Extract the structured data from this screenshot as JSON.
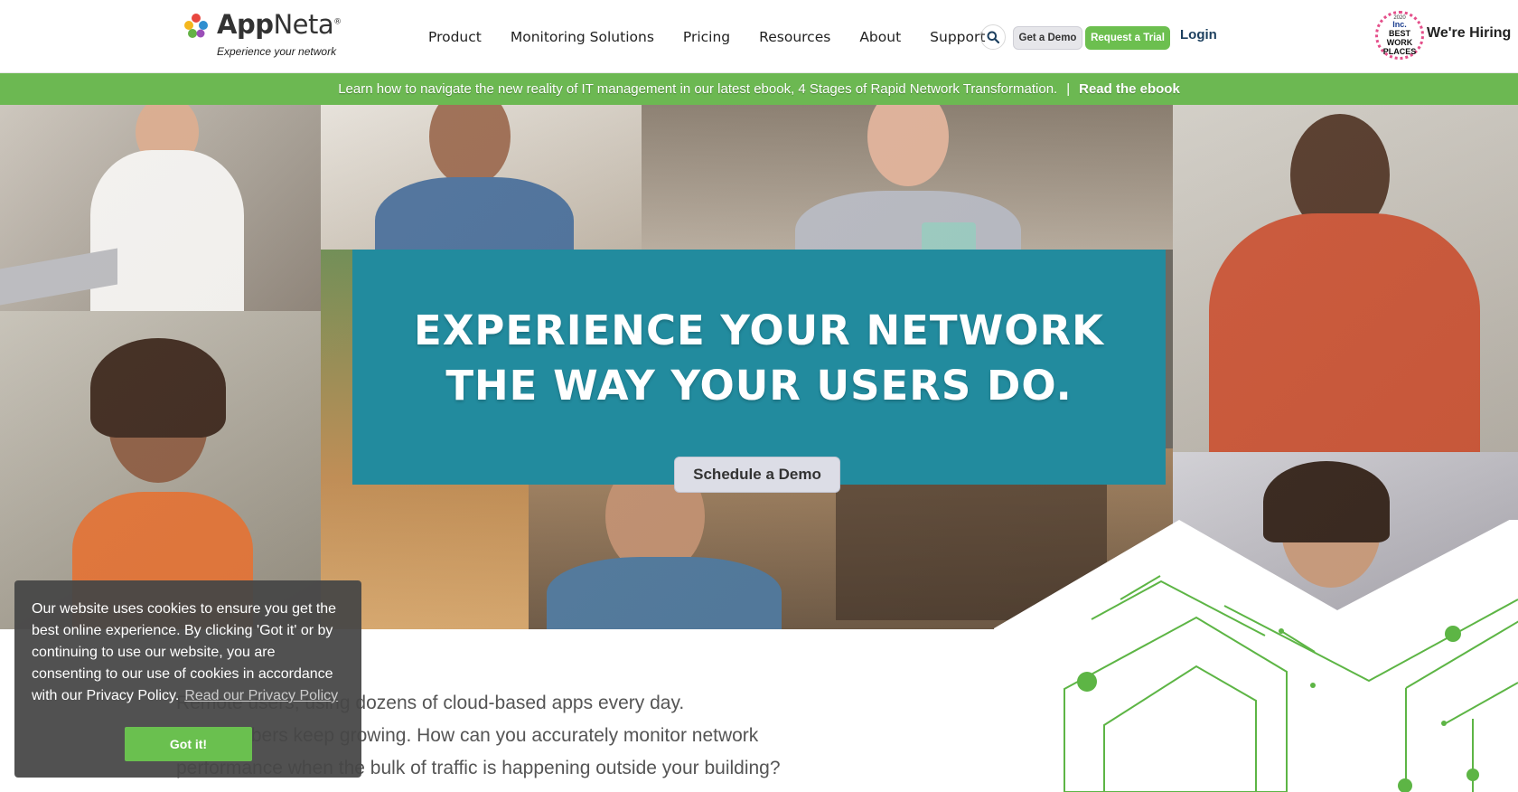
{
  "brand": {
    "name_bold": "App",
    "name_regular": "Neta",
    "tagline": "Experience your network",
    "trademark": "®"
  },
  "nav": {
    "items": [
      "Product",
      "Monitoring Solutions",
      "Pricing",
      "Resources",
      "About",
      "Support"
    ],
    "search_icon": "search-icon",
    "get_demo": "Get a Demo",
    "request_trial": "Request a Trial",
    "login": "Login",
    "badge": {
      "year": "2020",
      "inc": "Inc.",
      "best": "BEST WORK PLACES"
    },
    "hiring": "We're Hiring"
  },
  "announcement": {
    "text": "Learn how to navigate the new reality of IT management in our latest ebook, 4 Stages of Rapid Network Transformation.",
    "separator": "|",
    "link": "Read the ebook"
  },
  "hero": {
    "title": "EXPERIENCE YOUR NETWORK THE WAY YOUR USERS DO.",
    "cta": "Schedule a Demo"
  },
  "body": {
    "lines": [
      "Remote users, using dozens of cloud-based apps every day.",
      "The numbers keep growing. How can you accurately monitor network",
      "performance when the bulk of traffic is happening outside your building?"
    ]
  },
  "cookie": {
    "text": "Our website uses cookies to ensure you get the best online experience. By clicking 'Got it' or by continuing to use our website, you are consenting to our use of cookies in accordance with our Privacy Policy.",
    "link": "Read our Privacy Policy",
    "button": "Got it!"
  },
  "colors": {
    "accent_green": "#6cb852",
    "hero_teal": "#228b9e",
    "text_dark": "#222222"
  }
}
